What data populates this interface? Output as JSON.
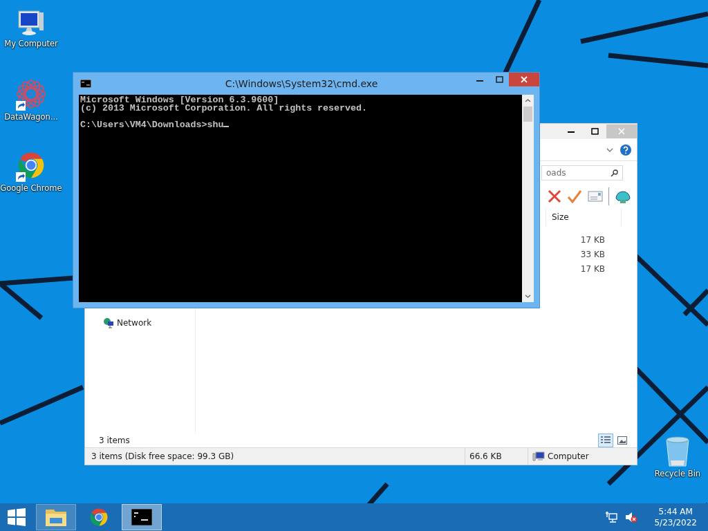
{
  "desktop_icons": [
    {
      "kind": "computer",
      "label": "My Computer"
    },
    {
      "kind": "app",
      "label": "DataWagon..."
    },
    {
      "kind": "chrome",
      "label": "Google Chrome"
    }
  ],
  "recycle_bin": {
    "label": "Recycle Bin"
  },
  "explorer": {
    "search": {
      "placeholder": "oads"
    },
    "columns": [
      "Size"
    ],
    "rows": [
      {
        "size": "17 KB"
      },
      {
        "size": "33 KB"
      },
      {
        "size": "17 KB"
      }
    ],
    "navigation": [
      {
        "label": "Network"
      }
    ],
    "item_count": "3 items",
    "view_buttons": [
      {
        "kind": "details",
        "selected": true
      },
      {
        "kind": "thumbnails",
        "selected": false
      }
    ],
    "status_bar": {
      "summary": "3 items (Disk free space: 99.3 GB)",
      "size": "66.6 KB",
      "location": "Computer"
    }
  },
  "console": {
    "title": "C:\\Windows\\System32\\cmd.exe",
    "lines": [
      "Microsoft Windows [Version 6.3.9600]",
      "(c) 2013 Microsoft Corporation. All rights reserved."
    ],
    "prompt": "C:\\Users\\VM4\\Downloads>shu"
  },
  "taskbar": {
    "items": [
      {
        "kind": "explorer",
        "running": true,
        "selected": false
      },
      {
        "kind": "chrome",
        "running": false,
        "selected": false
      },
      {
        "kind": "console",
        "running": true,
        "selected": true
      }
    ],
    "volume_muted": true,
    "clock": {
      "time": "5:44 AM",
      "date": "5/23/2022"
    }
  }
}
